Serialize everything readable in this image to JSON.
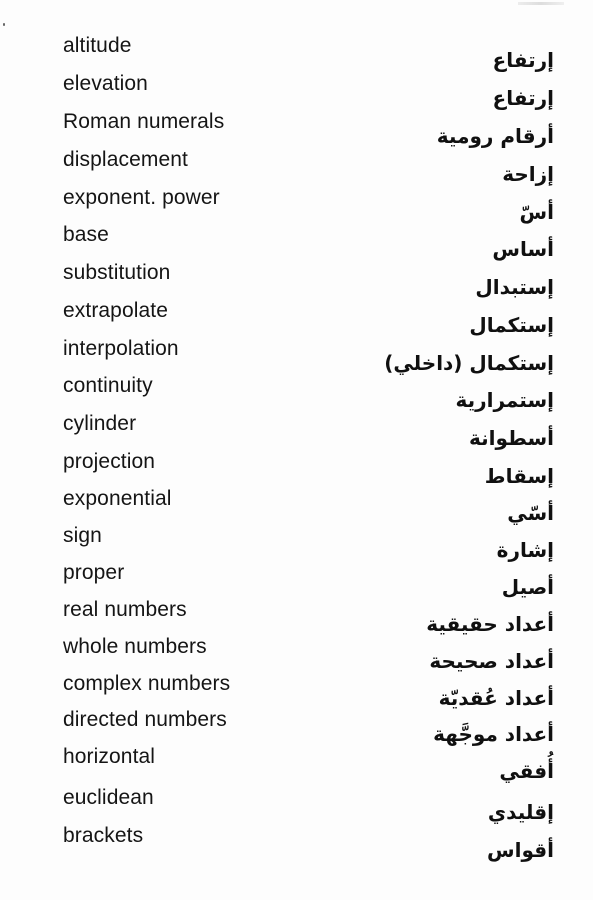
{
  "document": {
    "type": "bilingual-glossary",
    "languages": [
      "English",
      "Arabic"
    ]
  },
  "entries": [
    {
      "en": "altitude",
      "ar": "إرتفاع"
    },
    {
      "en": "elevation",
      "ar": "إرتفاع"
    },
    {
      "en": "Roman numerals",
      "ar": "أرقام رومية"
    },
    {
      "en": "displacement",
      "ar": "إزاحة"
    },
    {
      "en": "exponent. power",
      "ar": "أسّ"
    },
    {
      "en": "base",
      "ar": "أساس"
    },
    {
      "en": "substitution",
      "ar": "إستبدال"
    },
    {
      "en": "extrapolate",
      "ar": "إستكمال"
    },
    {
      "en": "interpolation",
      "ar": "إستكمال (داخلي)"
    },
    {
      "en": "continuity",
      "ar": "إستمرارية"
    },
    {
      "en": "cylinder",
      "ar": "أسطوانة"
    },
    {
      "en": "projection",
      "ar": "إسقاط"
    },
    {
      "en": "exponential",
      "ar": "أسّي"
    },
    {
      "en": "sign",
      "ar": "إشارة"
    },
    {
      "en": "proper",
      "ar": "أصيل"
    },
    {
      "en": "real numbers",
      "ar": "أعداد حقيقية"
    },
    {
      "en": "whole numbers",
      "ar": "أعداد صحيحة"
    },
    {
      "en": "complex numbers",
      "ar": "أعداد عُقديّة"
    },
    {
      "en": "directed numbers",
      "ar": "أعداد موجَّهة"
    },
    {
      "en": "horizontal",
      "ar": "أُفقي"
    },
    {
      "en": "euclidean",
      "ar": "إقليدي"
    },
    {
      "en": "brackets",
      "ar": "أقواس"
    }
  ]
}
